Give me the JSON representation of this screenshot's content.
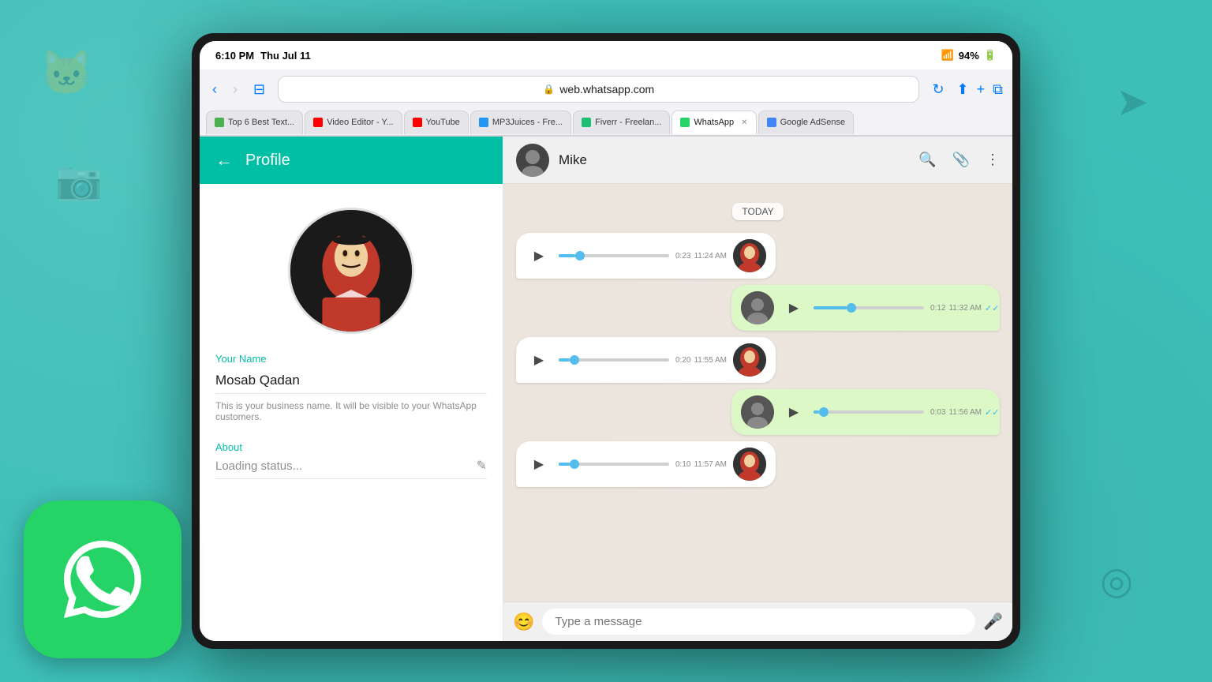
{
  "device": {
    "status_bar": {
      "time": "6:10 PM",
      "date": "Thu Jul 11",
      "wifi": "WiFi",
      "battery": "94%"
    }
  },
  "browser": {
    "address": "web.whatsapp.com",
    "lock_icon": "🔒",
    "back_btn": "‹",
    "forward_btn": "›",
    "reader_btn": "⊟",
    "refresh_btn": "↻",
    "share_btn": "⬆",
    "add_tab_btn": "+",
    "tabs_btn": "⧉",
    "tabs": [
      {
        "label": "Top 6 Best Text...",
        "active": false,
        "color": "#4CAF50"
      },
      {
        "label": "Video Editor - Y...",
        "active": false,
        "color": "#f00"
      },
      {
        "label": "YouTube",
        "active": false,
        "color": "#f00"
      },
      {
        "label": "MP3Juices - Fre...",
        "active": false,
        "color": "#2196F3"
      },
      {
        "label": "Fiverr - Freelan...",
        "active": false,
        "color": "#1dbf73"
      },
      {
        "label": "WhatsApp",
        "active": true,
        "color": "#25d366"
      },
      {
        "label": "Google AdSense",
        "active": false,
        "color": "#4285f4"
      }
    ]
  },
  "profile": {
    "title": "Profile",
    "back_btn": "←",
    "name_label": "Your Name",
    "name_value": "Mosab Qadan",
    "name_hint": "This is your business name. It will be visible to your WhatsApp customers.",
    "about_label": "About",
    "about_value": "Loading status...",
    "edit_icon": "✎"
  },
  "chat": {
    "contact_name": "Mike",
    "search_btn": "🔍",
    "attach_btn": "📎",
    "more_btn": "⋮",
    "date_divider": "TODAY",
    "messages": [
      {
        "type": "received",
        "duration": "0:23",
        "time": "11:24 AM",
        "progress": 0.15,
        "has_avatar": true
      },
      {
        "type": "sent",
        "duration": "0:12",
        "time": "11:32 AM",
        "progress": 0.3,
        "has_avatar": true,
        "read": true
      },
      {
        "type": "received",
        "duration": "0:20",
        "time": "11:55 AM",
        "progress": 0.1,
        "has_avatar": true
      },
      {
        "type": "sent",
        "duration": "0:03",
        "time": "11:56 AM",
        "progress": 0.05,
        "has_avatar": true,
        "read": true
      },
      {
        "type": "received",
        "duration": "0:10",
        "time": "11:57 AM",
        "progress": 0.1,
        "has_avatar": true
      }
    ],
    "input": {
      "placeholder": "Type a message"
    }
  },
  "whatsapp_logo": {
    "alt": "WhatsApp"
  }
}
